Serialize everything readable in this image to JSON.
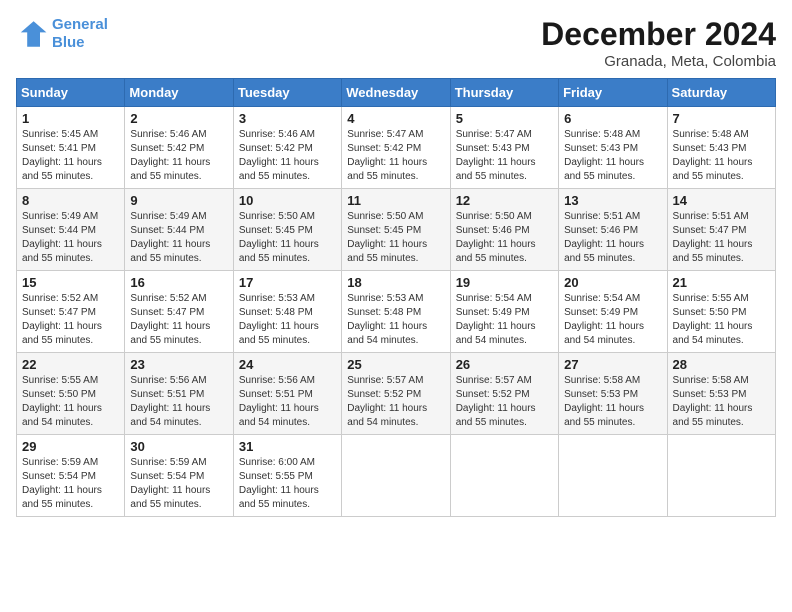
{
  "header": {
    "logo_line1": "General",
    "logo_line2": "Blue",
    "title": "December 2024",
    "subtitle": "Granada, Meta, Colombia"
  },
  "days_of_week": [
    "Sunday",
    "Monday",
    "Tuesday",
    "Wednesday",
    "Thursday",
    "Friday",
    "Saturday"
  ],
  "weeks": [
    [
      {
        "day": "1",
        "sunrise": "5:45 AM",
        "sunset": "5:41 PM",
        "daylight": "11 hours and 55 minutes."
      },
      {
        "day": "2",
        "sunrise": "5:46 AM",
        "sunset": "5:42 PM",
        "daylight": "11 hours and 55 minutes."
      },
      {
        "day": "3",
        "sunrise": "5:46 AM",
        "sunset": "5:42 PM",
        "daylight": "11 hours and 55 minutes."
      },
      {
        "day": "4",
        "sunrise": "5:47 AM",
        "sunset": "5:42 PM",
        "daylight": "11 hours and 55 minutes."
      },
      {
        "day": "5",
        "sunrise": "5:47 AM",
        "sunset": "5:43 PM",
        "daylight": "11 hours and 55 minutes."
      },
      {
        "day": "6",
        "sunrise": "5:48 AM",
        "sunset": "5:43 PM",
        "daylight": "11 hours and 55 minutes."
      },
      {
        "day": "7",
        "sunrise": "5:48 AM",
        "sunset": "5:43 PM",
        "daylight": "11 hours and 55 minutes."
      }
    ],
    [
      {
        "day": "8",
        "sunrise": "5:49 AM",
        "sunset": "5:44 PM",
        "daylight": "11 hours and 55 minutes."
      },
      {
        "day": "9",
        "sunrise": "5:49 AM",
        "sunset": "5:44 PM",
        "daylight": "11 hours and 55 minutes."
      },
      {
        "day": "10",
        "sunrise": "5:50 AM",
        "sunset": "5:45 PM",
        "daylight": "11 hours and 55 minutes."
      },
      {
        "day": "11",
        "sunrise": "5:50 AM",
        "sunset": "5:45 PM",
        "daylight": "11 hours and 55 minutes."
      },
      {
        "day": "12",
        "sunrise": "5:50 AM",
        "sunset": "5:46 PM",
        "daylight": "11 hours and 55 minutes."
      },
      {
        "day": "13",
        "sunrise": "5:51 AM",
        "sunset": "5:46 PM",
        "daylight": "11 hours and 55 minutes."
      },
      {
        "day": "14",
        "sunrise": "5:51 AM",
        "sunset": "5:47 PM",
        "daylight": "11 hours and 55 minutes."
      }
    ],
    [
      {
        "day": "15",
        "sunrise": "5:52 AM",
        "sunset": "5:47 PM",
        "daylight": "11 hours and 55 minutes."
      },
      {
        "day": "16",
        "sunrise": "5:52 AM",
        "sunset": "5:47 PM",
        "daylight": "11 hours and 55 minutes."
      },
      {
        "day": "17",
        "sunrise": "5:53 AM",
        "sunset": "5:48 PM",
        "daylight": "11 hours and 55 minutes."
      },
      {
        "day": "18",
        "sunrise": "5:53 AM",
        "sunset": "5:48 PM",
        "daylight": "11 hours and 54 minutes."
      },
      {
        "day": "19",
        "sunrise": "5:54 AM",
        "sunset": "5:49 PM",
        "daylight": "11 hours and 54 minutes."
      },
      {
        "day": "20",
        "sunrise": "5:54 AM",
        "sunset": "5:49 PM",
        "daylight": "11 hours and 54 minutes."
      },
      {
        "day": "21",
        "sunrise": "5:55 AM",
        "sunset": "5:50 PM",
        "daylight": "11 hours and 54 minutes."
      }
    ],
    [
      {
        "day": "22",
        "sunrise": "5:55 AM",
        "sunset": "5:50 PM",
        "daylight": "11 hours and 54 minutes."
      },
      {
        "day": "23",
        "sunrise": "5:56 AM",
        "sunset": "5:51 PM",
        "daylight": "11 hours and 54 minutes."
      },
      {
        "day": "24",
        "sunrise": "5:56 AM",
        "sunset": "5:51 PM",
        "daylight": "11 hours and 54 minutes."
      },
      {
        "day": "25",
        "sunrise": "5:57 AM",
        "sunset": "5:52 PM",
        "daylight": "11 hours and 54 minutes."
      },
      {
        "day": "26",
        "sunrise": "5:57 AM",
        "sunset": "5:52 PM",
        "daylight": "11 hours and 55 minutes."
      },
      {
        "day": "27",
        "sunrise": "5:58 AM",
        "sunset": "5:53 PM",
        "daylight": "11 hours and 55 minutes."
      },
      {
        "day": "28",
        "sunrise": "5:58 AM",
        "sunset": "5:53 PM",
        "daylight": "11 hours and 55 minutes."
      }
    ],
    [
      {
        "day": "29",
        "sunrise": "5:59 AM",
        "sunset": "5:54 PM",
        "daylight": "11 hours and 55 minutes."
      },
      {
        "day": "30",
        "sunrise": "5:59 AM",
        "sunset": "5:54 PM",
        "daylight": "11 hours and 55 minutes."
      },
      {
        "day": "31",
        "sunrise": "6:00 AM",
        "sunset": "5:55 PM",
        "daylight": "11 hours and 55 minutes."
      },
      null,
      null,
      null,
      null
    ]
  ]
}
